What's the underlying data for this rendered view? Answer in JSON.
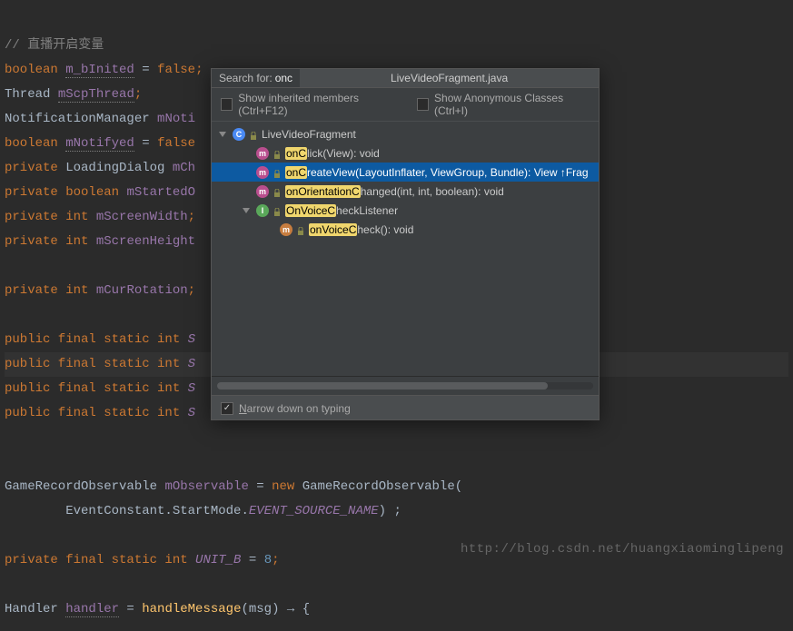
{
  "code": {
    "line1_comment": "// 直播开启变量",
    "line2_kw": "boolean",
    "line2_field": "m_bInited",
    "line2_rest": " = ",
    "line2_val": "false",
    "line3_type": "Thread",
    "line3_field": "mScpThread",
    "line4_type": "NotificationManager",
    "line4_field": "mNoti",
    "line5_kw": "boolean",
    "line5_field": "mNotifyed",
    "line5_rest": " = ",
    "line5_val": "false",
    "line6_kw": "private",
    "line6_type": "LoadingDialog",
    "line6_field": "mCh",
    "line7_kw1": "private",
    "line7_kw2": "boolean",
    "line7_field": "mStartedO",
    "line8_kw1": "private",
    "line8_kw2": "int",
    "line8_field": "mScreenWidth",
    "line9_kw1": "private",
    "line9_kw2": "int",
    "line9_field": "mScreenHeight",
    "line10_kw1": "private",
    "line10_kw2": "int",
    "line10_field": "mCurRotation",
    "line11_pf": "public final static int ",
    "line11_field": "S",
    "line15_type": "GameRecordObservable",
    "line15_field": "mObservable",
    "line15_eq": " = ",
    "line15_new": "new",
    "line15_class": "GameRecordObservable",
    "line15_open": "(",
    "line16_pre": "        EventConstant.StartMode.",
    "line16_const": "EVENT_SOURCE_NAME",
    "line16_end": ") ;",
    "line17_kw": "private final static int ",
    "line17_field": "UNIT_B",
    "line17_eq": " = ",
    "line17_val": "8",
    "line18_type": "Handler ",
    "line18_field": "handler",
    "line18_eq": " = ",
    "line18_method": "handleMessage",
    "line18_open": "(msg) ",
    "line18_arrow": "→",
    "line18_brace": " {"
  },
  "popup": {
    "search_label": "Search for:",
    "search_term": "onc",
    "file_title": "LiveVideoFragment.java",
    "opt_inherited": "Show inherited members (Ctrl+F12)",
    "opt_anonymous": "Show Anonymous Classes (Ctrl+I)",
    "narrow_prefix": "N",
    "narrow_rest": "arrow down on typing"
  },
  "tree": [
    {
      "level": 0,
      "icon": "class",
      "lock": true,
      "arrow": true,
      "hl": "",
      "text": "LiveVideoFragment",
      "selected": false
    },
    {
      "level": 1,
      "icon": "method",
      "lock": true,
      "arrow": false,
      "hl": "onC",
      "text": "lick(View): void",
      "selected": false
    },
    {
      "level": 1,
      "icon": "method",
      "lock": true,
      "arrow": false,
      "hl": "onC",
      "text": "reateView(LayoutInflater, ViewGroup, Bundle): View ↑Frag",
      "selected": true
    },
    {
      "level": 1,
      "icon": "method",
      "lock": true,
      "arrow": false,
      "hl": "onOrientationC",
      "text": "hanged(int, int, boolean): void",
      "selected": false
    },
    {
      "level": 1,
      "icon": "interface",
      "lock": true,
      "arrow": true,
      "hl": "OnVoiceC",
      "text": "heckListener",
      "selected": false
    },
    {
      "level": 2,
      "icon": "method-impl",
      "lock": true,
      "arrow": false,
      "hl": "onVoiceC",
      "text": "heck(): void",
      "selected": false
    }
  ],
  "watermark": "http://blog.csdn.net/huangxiaominglipeng"
}
